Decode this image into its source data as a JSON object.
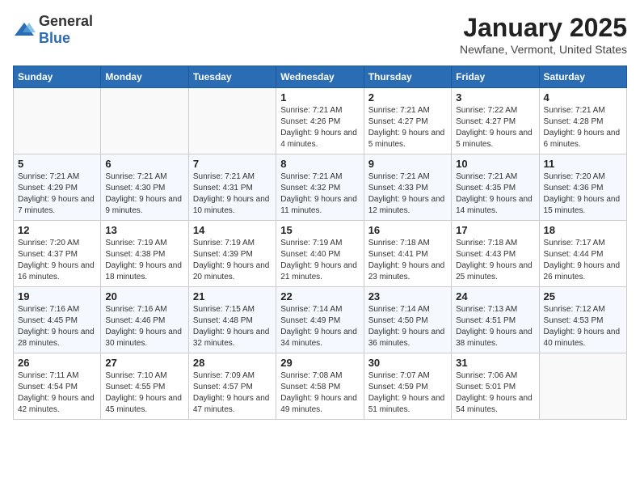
{
  "header": {
    "logo_general": "General",
    "logo_blue": "Blue",
    "title": "January 2025",
    "location": "Newfane, Vermont, United States"
  },
  "days_of_week": [
    "Sunday",
    "Monday",
    "Tuesday",
    "Wednesday",
    "Thursday",
    "Friday",
    "Saturday"
  ],
  "weeks": [
    [
      {
        "day": "",
        "info": ""
      },
      {
        "day": "",
        "info": ""
      },
      {
        "day": "",
        "info": ""
      },
      {
        "day": "1",
        "info": "Sunrise: 7:21 AM\nSunset: 4:26 PM\nDaylight: 9 hours and 4 minutes."
      },
      {
        "day": "2",
        "info": "Sunrise: 7:21 AM\nSunset: 4:27 PM\nDaylight: 9 hours and 5 minutes."
      },
      {
        "day": "3",
        "info": "Sunrise: 7:22 AM\nSunset: 4:27 PM\nDaylight: 9 hours and 5 minutes."
      },
      {
        "day": "4",
        "info": "Sunrise: 7:21 AM\nSunset: 4:28 PM\nDaylight: 9 hours and 6 minutes."
      }
    ],
    [
      {
        "day": "5",
        "info": "Sunrise: 7:21 AM\nSunset: 4:29 PM\nDaylight: 9 hours and 7 minutes."
      },
      {
        "day": "6",
        "info": "Sunrise: 7:21 AM\nSunset: 4:30 PM\nDaylight: 9 hours and 9 minutes."
      },
      {
        "day": "7",
        "info": "Sunrise: 7:21 AM\nSunset: 4:31 PM\nDaylight: 9 hours and 10 minutes."
      },
      {
        "day": "8",
        "info": "Sunrise: 7:21 AM\nSunset: 4:32 PM\nDaylight: 9 hours and 11 minutes."
      },
      {
        "day": "9",
        "info": "Sunrise: 7:21 AM\nSunset: 4:33 PM\nDaylight: 9 hours and 12 minutes."
      },
      {
        "day": "10",
        "info": "Sunrise: 7:21 AM\nSunset: 4:35 PM\nDaylight: 9 hours and 14 minutes."
      },
      {
        "day": "11",
        "info": "Sunrise: 7:20 AM\nSunset: 4:36 PM\nDaylight: 9 hours and 15 minutes."
      }
    ],
    [
      {
        "day": "12",
        "info": "Sunrise: 7:20 AM\nSunset: 4:37 PM\nDaylight: 9 hours and 16 minutes."
      },
      {
        "day": "13",
        "info": "Sunrise: 7:19 AM\nSunset: 4:38 PM\nDaylight: 9 hours and 18 minutes."
      },
      {
        "day": "14",
        "info": "Sunrise: 7:19 AM\nSunset: 4:39 PM\nDaylight: 9 hours and 20 minutes."
      },
      {
        "day": "15",
        "info": "Sunrise: 7:19 AM\nSunset: 4:40 PM\nDaylight: 9 hours and 21 minutes."
      },
      {
        "day": "16",
        "info": "Sunrise: 7:18 AM\nSunset: 4:41 PM\nDaylight: 9 hours and 23 minutes."
      },
      {
        "day": "17",
        "info": "Sunrise: 7:18 AM\nSunset: 4:43 PM\nDaylight: 9 hours and 25 minutes."
      },
      {
        "day": "18",
        "info": "Sunrise: 7:17 AM\nSunset: 4:44 PM\nDaylight: 9 hours and 26 minutes."
      }
    ],
    [
      {
        "day": "19",
        "info": "Sunrise: 7:16 AM\nSunset: 4:45 PM\nDaylight: 9 hours and 28 minutes."
      },
      {
        "day": "20",
        "info": "Sunrise: 7:16 AM\nSunset: 4:46 PM\nDaylight: 9 hours and 30 minutes."
      },
      {
        "day": "21",
        "info": "Sunrise: 7:15 AM\nSunset: 4:48 PM\nDaylight: 9 hours and 32 minutes."
      },
      {
        "day": "22",
        "info": "Sunrise: 7:14 AM\nSunset: 4:49 PM\nDaylight: 9 hours and 34 minutes."
      },
      {
        "day": "23",
        "info": "Sunrise: 7:14 AM\nSunset: 4:50 PM\nDaylight: 9 hours and 36 minutes."
      },
      {
        "day": "24",
        "info": "Sunrise: 7:13 AM\nSunset: 4:51 PM\nDaylight: 9 hours and 38 minutes."
      },
      {
        "day": "25",
        "info": "Sunrise: 7:12 AM\nSunset: 4:53 PM\nDaylight: 9 hours and 40 minutes."
      }
    ],
    [
      {
        "day": "26",
        "info": "Sunrise: 7:11 AM\nSunset: 4:54 PM\nDaylight: 9 hours and 42 minutes."
      },
      {
        "day": "27",
        "info": "Sunrise: 7:10 AM\nSunset: 4:55 PM\nDaylight: 9 hours and 45 minutes."
      },
      {
        "day": "28",
        "info": "Sunrise: 7:09 AM\nSunset: 4:57 PM\nDaylight: 9 hours and 47 minutes."
      },
      {
        "day": "29",
        "info": "Sunrise: 7:08 AM\nSunset: 4:58 PM\nDaylight: 9 hours and 49 minutes."
      },
      {
        "day": "30",
        "info": "Sunrise: 7:07 AM\nSunset: 4:59 PM\nDaylight: 9 hours and 51 minutes."
      },
      {
        "day": "31",
        "info": "Sunrise: 7:06 AM\nSunset: 5:01 PM\nDaylight: 9 hours and 54 minutes."
      },
      {
        "day": "",
        "info": ""
      }
    ]
  ]
}
